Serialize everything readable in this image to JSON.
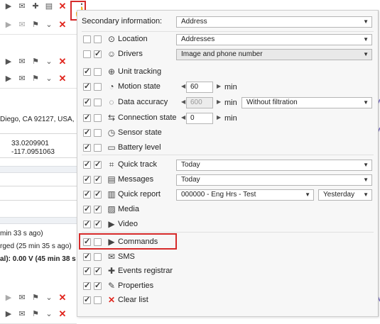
{
  "background": {
    "address_text": "Diego, CA 92127, USA,",
    "coord_lat": "33.0209901",
    "coord_lon": "-117.0951063",
    "status_1": "min 33 s ago)",
    "status_2": "rged (25 min 35 s ago)",
    "status_3": "al): 0.00 V (45 min 38 s"
  },
  "panel": {
    "secondary": {
      "label": "Secondary information:",
      "value": "Address"
    },
    "rows": [
      {
        "label": "Location",
        "icon": "⊙",
        "c1": false,
        "c2": false,
        "select": "Addresses"
      },
      {
        "label": "Drivers",
        "icon": "☺",
        "c1": false,
        "c2": true,
        "select": "Image and phone number"
      },
      {
        "label": "Unit tracking",
        "icon": "⊕",
        "c1": true,
        "c2": false
      },
      {
        "label": "Motion state",
        "icon": "◔",
        "c1": true,
        "c2": false,
        "num": "60",
        "unit": "min"
      },
      {
        "label": "Data accuracy",
        "icon": "◌",
        "c1": true,
        "c2": false,
        "num": "600",
        "unit": "min",
        "select": "Without filtration"
      },
      {
        "label": "Connection state",
        "icon": "⇆",
        "c1": true,
        "c2": false,
        "num": "0",
        "unit": "min"
      },
      {
        "label": "Sensor state",
        "icon": "◷",
        "c1": true,
        "c2": false
      },
      {
        "label": "Battery level",
        "icon": "▭",
        "c1": true,
        "c2": false
      },
      {
        "label": "Quick track",
        "icon": "⌗",
        "c1": true,
        "c2": true,
        "select": "Today"
      },
      {
        "label": "Messages",
        "icon": "▤",
        "c1": true,
        "c2": true,
        "select": "Today"
      },
      {
        "label": "Quick report",
        "icon": "▥",
        "c1": true,
        "c2": true,
        "select": "000000 - Eng Hrs - Test",
        "select2": "Yesterday"
      },
      {
        "label": "Media",
        "icon": "▨",
        "c1": true,
        "c2": true
      },
      {
        "label": "Video",
        "icon": "▶",
        "c1": true,
        "c2": true
      },
      {
        "label": "Commands",
        "icon": "▶",
        "c1": true,
        "c2": false
      },
      {
        "label": "SMS",
        "icon": "✉",
        "c1": true,
        "c2": false
      },
      {
        "label": "Events registrar",
        "icon": "✚",
        "c1": true,
        "c2": true
      },
      {
        "label": "Properties",
        "icon": "✎",
        "c1": true,
        "c2": true
      },
      {
        "label": "Clear list",
        "icon": "✕",
        "c1": true,
        "c2": false
      }
    ]
  }
}
